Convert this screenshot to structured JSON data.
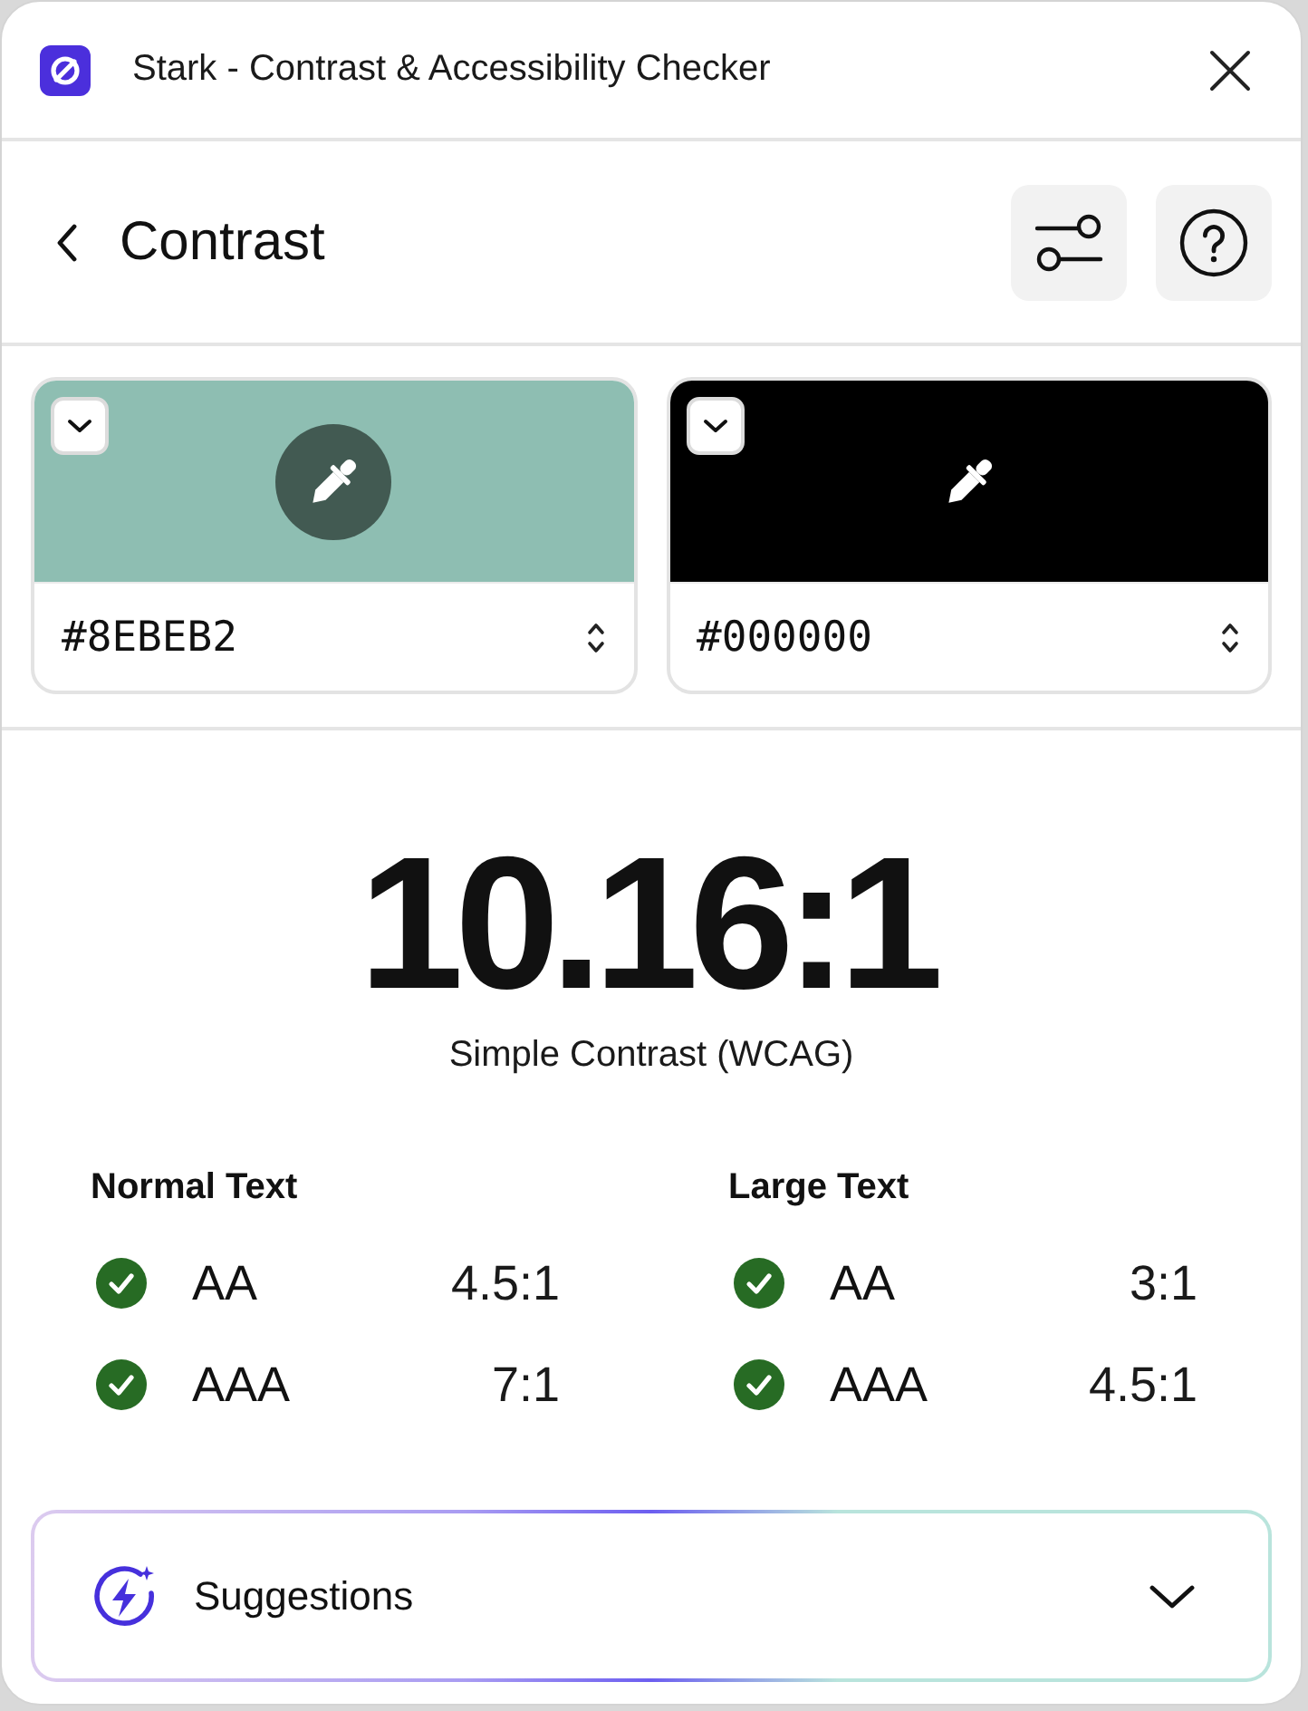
{
  "window": {
    "title": "Stark - Contrast & Accessibility Checker"
  },
  "header": {
    "title": "Contrast"
  },
  "colors": [
    {
      "value": "#8EBEB2",
      "color": "#8ebeb2",
      "picker_active": true
    },
    {
      "value": "#000000",
      "color": "#000000",
      "picker_active": false
    }
  ],
  "result": {
    "ratio": "10.16:1",
    "method": "Simple Contrast (WCAG)"
  },
  "groups": [
    {
      "title": "Normal Text",
      "checks": [
        {
          "level": "AA",
          "ratio": "4.5:1",
          "passed": true
        },
        {
          "level": "AAA",
          "ratio": "7:1",
          "passed": true
        }
      ]
    },
    {
      "title": "Large Text",
      "checks": [
        {
          "level": "AA",
          "ratio": "3:1",
          "passed": true
        },
        {
          "level": "AAA",
          "ratio": "4.5:1",
          "passed": true
        }
      ]
    }
  ],
  "suggestions": {
    "label": "Suggestions",
    "expanded": false
  }
}
